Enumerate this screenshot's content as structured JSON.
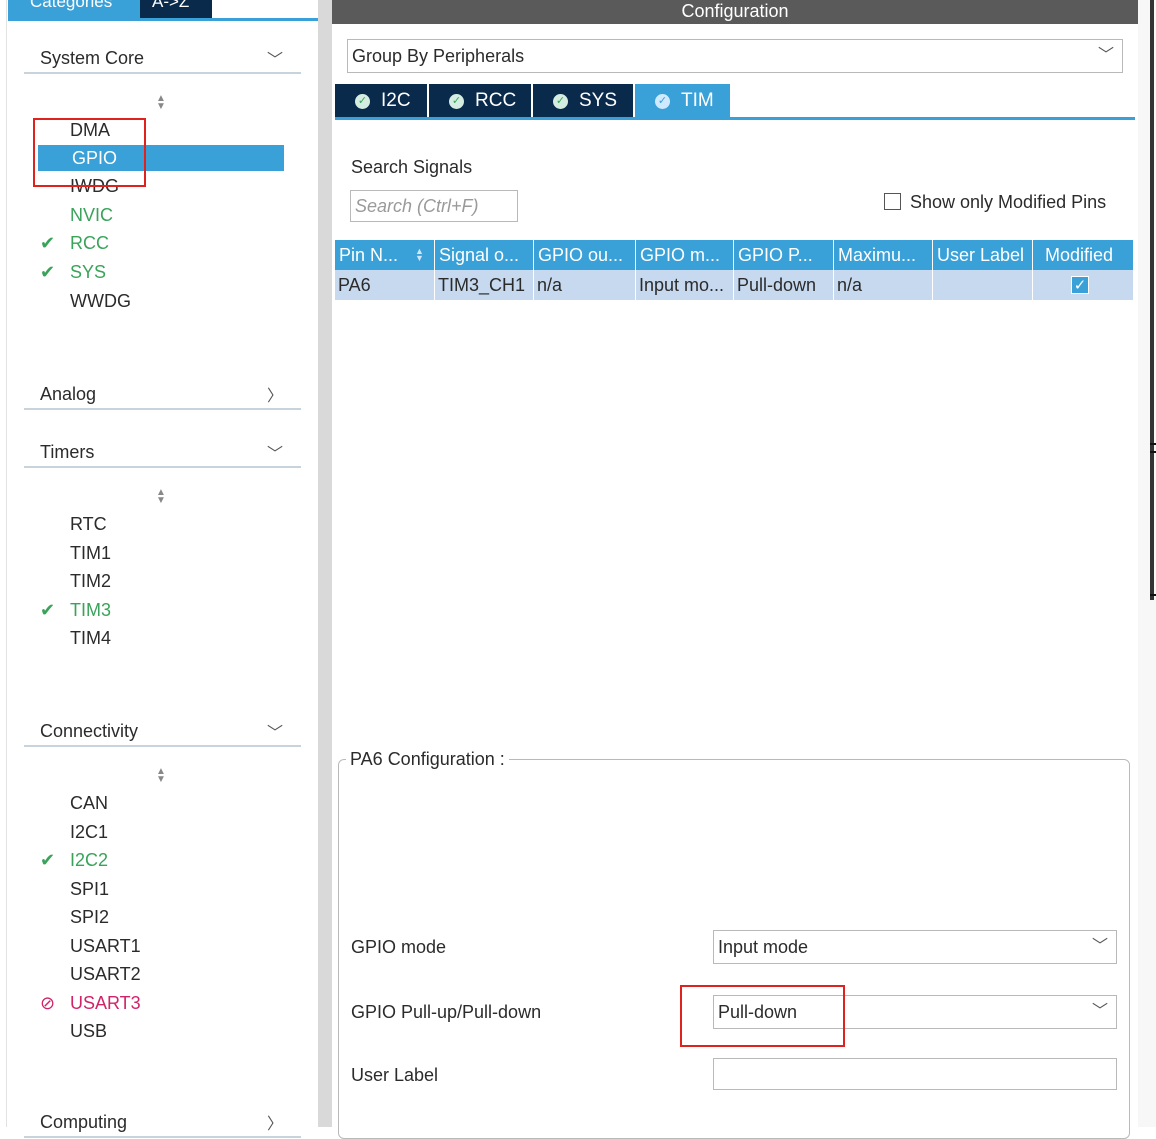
{
  "left": {
    "tabs": [
      "Categories",
      "A->Z"
    ],
    "groups": [
      {
        "title": "System Core",
        "chevron": "chevron-down-icon",
        "items": [
          {
            "label": "DMA",
            "status": "none"
          },
          {
            "label": "GPIO",
            "status": "selected"
          },
          {
            "label": "IWDG",
            "status": "none"
          },
          {
            "label": "NVIC",
            "status": "ok-text"
          },
          {
            "label": "RCC",
            "status": "ok"
          },
          {
            "label": "SYS",
            "status": "ok"
          },
          {
            "label": "WWDG",
            "status": "none"
          }
        ]
      },
      {
        "title": "Analog",
        "chevron": "chevron-right-icon",
        "items": []
      },
      {
        "title": "Timers",
        "chevron": "chevron-down-icon",
        "items": [
          {
            "label": "RTC",
            "status": "none"
          },
          {
            "label": "TIM1",
            "status": "none"
          },
          {
            "label": "TIM2",
            "status": "none"
          },
          {
            "label": "TIM3",
            "status": "ok"
          },
          {
            "label": "TIM4",
            "status": "none"
          }
        ]
      },
      {
        "title": "Connectivity",
        "chevron": "chevron-down-icon",
        "items": [
          {
            "label": "CAN",
            "status": "none"
          },
          {
            "label": "I2C1",
            "status": "none"
          },
          {
            "label": "I2C2",
            "status": "ok"
          },
          {
            "label": "SPI1",
            "status": "none"
          },
          {
            "label": "SPI2",
            "status": "none"
          },
          {
            "label": "USART1",
            "status": "none"
          },
          {
            "label": "USART2",
            "status": "none"
          },
          {
            "label": "USART3",
            "status": "error"
          },
          {
            "label": "USB",
            "status": "none"
          }
        ]
      },
      {
        "title": "Computing",
        "chevron": "chevron-right-icon",
        "items": []
      }
    ],
    "colors": {
      "selected": "#39a0d8",
      "ok": "#3aa35a",
      "error": "#d0246a"
    }
  },
  "config": {
    "header": "Configuration",
    "group_by": "Group By Peripherals",
    "tabs": [
      {
        "label": "I2C",
        "active": false
      },
      {
        "label": "RCC",
        "active": false
      },
      {
        "label": "SYS",
        "active": false
      },
      {
        "label": "TIM",
        "active": true
      }
    ],
    "search_label": "Search Signals",
    "search_placeholder": "Search (Ctrl+F)",
    "show_modified_label": "Show only Modified Pins",
    "table": {
      "headers": [
        "Pin N...",
        "Signal o...",
        "GPIO ou...",
        "GPIO m...",
        "GPIO P...",
        "Maximu...",
        "User Label",
        "Modified"
      ],
      "rows": [
        [
          "PA6",
          "TIM3_CH1",
          "n/a",
          "Input mo...",
          "Pull-down",
          "n/a",
          "",
          "✓"
        ]
      ]
    },
    "pin_config_title": "PA6 Configuration :",
    "fields": {
      "gpio_mode_label": "GPIO mode",
      "gpio_mode_value": "Input mode",
      "pull_label": "GPIO Pull-up/Pull-down",
      "pull_value": "Pull-down",
      "user_label_label": "User Label",
      "user_label_value": ""
    }
  }
}
